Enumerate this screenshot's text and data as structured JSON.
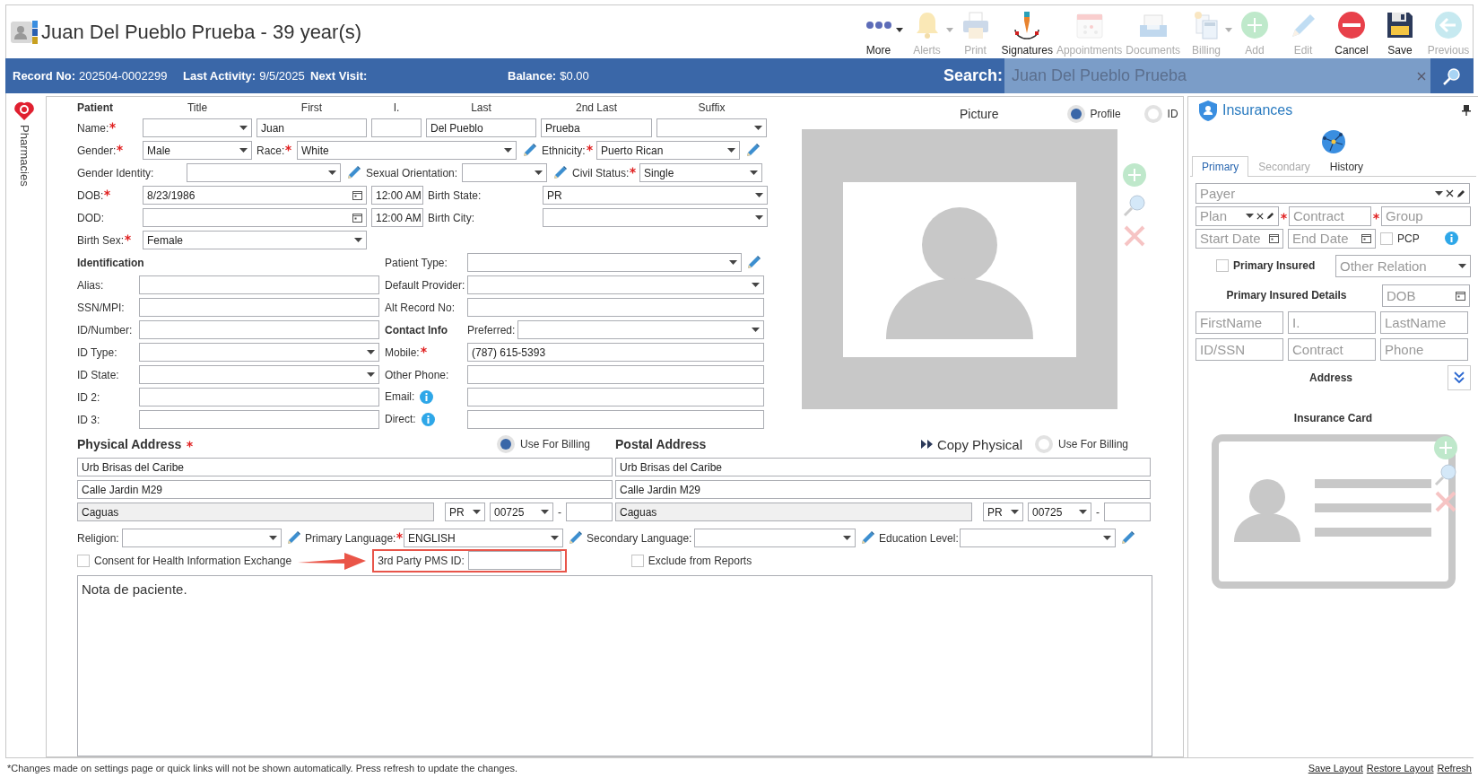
{
  "header": {
    "title": "Juan Del Pueblo Prueba - 39 year(s)"
  },
  "toolbar": [
    {
      "label": "More",
      "kind": "more",
      "disabled": false,
      "menu": true
    },
    {
      "label": "Alerts",
      "kind": "alerts",
      "disabled": true,
      "menu": true
    },
    {
      "label": "Print",
      "kind": "print",
      "disabled": true,
      "menu": false
    },
    {
      "label": "Signatures",
      "kind": "signatures",
      "disabled": false,
      "menu": false
    },
    {
      "label": "Appointments",
      "kind": "appointments",
      "disabled": true,
      "menu": false
    },
    {
      "label": "Documents",
      "kind": "documents",
      "disabled": true,
      "menu": false
    },
    {
      "label": "Billing",
      "kind": "billing",
      "disabled": true,
      "menu": true
    },
    {
      "label": "Add",
      "kind": "add",
      "disabled": true,
      "menu": false
    },
    {
      "label": "Edit",
      "kind": "edit",
      "disabled": true,
      "menu": false
    },
    {
      "label": "Cancel",
      "kind": "cancel",
      "disabled": false,
      "menu": false
    },
    {
      "label": "Save",
      "kind": "save",
      "disabled": false,
      "menu": false
    },
    {
      "label": "Previous",
      "kind": "previous",
      "disabled": true,
      "menu": false
    }
  ],
  "info_bar": {
    "items": [
      {
        "label": "Record No:",
        "value": "202504-0002299"
      },
      {
        "label": "Last Activity:",
        "value": "9/5/2025"
      },
      {
        "label": "Next Visit:"
      },
      {
        "label": "Balance:",
        "value": "$0.00"
      }
    ],
    "search": {
      "label": "Search:",
      "placeholder": "Juan Del Pueblo Prueba"
    }
  },
  "side_tab": {
    "label": "Pharmacies"
  },
  "patient": {
    "heading": "Patient",
    "columns": [
      "Title",
      "First",
      "I.",
      "Last",
      "2nd Last",
      "Suffix"
    ],
    "name": {
      "label": "Name:",
      "required": true,
      "first": "Juan",
      "last": "Del Pueblo",
      "second_last": "Prueba"
    },
    "gender": {
      "label": "Gender:",
      "required": true,
      "value": "Male"
    },
    "race": {
      "label": "Race:",
      "required": true,
      "value": "White"
    },
    "ethnicity": {
      "label": "Ethnicity:",
      "required": true,
      "value": "Puerto Rican"
    },
    "gender_identity": {
      "label": "Gender Identity:",
      "required": false
    },
    "sexual_orientation": {
      "label": "Sexual Orientation:",
      "required": false
    },
    "civil_status": {
      "label": "Civil Status:",
      "required": true,
      "value": "Single"
    },
    "dob": {
      "label": "DOB:",
      "required": true,
      "value": "8/23/1986",
      "time": "12:00 AM"
    },
    "birth_state": {
      "label": "Birth State:",
      "required": false,
      "value": "PR"
    },
    "dod": {
      "label": "DOD:",
      "required": false,
      "time": "12:00 AM"
    },
    "birth_city": {
      "label": "Birth City:",
      "required": false
    },
    "birth_sex": {
      "label": "Birth Sex:",
      "required": true,
      "value": "Female"
    }
  },
  "identification": {
    "heading": "Identification",
    "fields": [
      {
        "label": "Alias:",
        "kind": "text"
      },
      {
        "label": "SSN/MPI:",
        "kind": "text"
      },
      {
        "label": "ID/Number:",
        "kind": "text"
      },
      {
        "label": "ID Type:",
        "kind": "select"
      },
      {
        "label": "ID State:",
        "kind": "select"
      },
      {
        "label": "ID 2:",
        "kind": "text"
      },
      {
        "label": "ID 3:",
        "kind": "text"
      }
    ]
  },
  "details": [
    {
      "label": "Patient Type:",
      "kind": "select",
      "required": false,
      "pencil": true,
      "info": false
    },
    {
      "label": "Default Provider:",
      "kind": "select",
      "required": false,
      "pencil": false,
      "info": false
    },
    {
      "label": "Alt Record No:",
      "kind": "text",
      "required": false,
      "pencil": false,
      "info": false
    },
    {
      "label": "Contact Info",
      "kind": "heading",
      "sub_label": "Preferred:",
      "required": false,
      "pencil": false,
      "info": false
    },
    {
      "label": "Mobile:",
      "kind": "text",
      "value": "(787) 615-5393",
      "required": true,
      "pencil": false,
      "info": false
    },
    {
      "label": "Other Phone:",
      "kind": "text",
      "required": false,
      "pencil": false,
      "info": false
    },
    {
      "label": "Email:",
      "kind": "text",
      "required": false,
      "pencil": false,
      "info": true
    },
    {
      "label": "Direct:",
      "kind": "text",
      "required": false,
      "pencil": false,
      "info": true
    }
  ],
  "picture": {
    "heading": "Picture",
    "options": [
      {
        "label": "Profile",
        "selected": true
      },
      {
        "label": "ID",
        "selected": false
      }
    ]
  },
  "physical_address": {
    "heading": "Physical Address",
    "required": true,
    "billing": {
      "label": "Use For Billing",
      "selected": true
    },
    "line1": "Urb Brisas del Caribe",
    "line2": "Calle Jardin M29",
    "city": "Caguas",
    "state": "PR",
    "zip": "00725",
    "separator": "-"
  },
  "postal_address": {
    "heading": "Postal Address",
    "copy_label": "Copy Physical",
    "billing": {
      "label": "Use For Billing",
      "selected": false
    },
    "line1": "Urb Brisas del Caribe",
    "line2": "Calle Jardin M29",
    "city": "Caguas",
    "state": "PR",
    "zip": "00725",
    "separator": "-"
  },
  "other_fields": [
    {
      "label": "Religion:",
      "required": false
    },
    {
      "label": "Primary Language:",
      "required": true,
      "value": "ENGLISH"
    },
    {
      "label": "Secondary Language:",
      "required": false
    },
    {
      "label": "Education Level:",
      "required": false
    }
  ],
  "consent": {
    "label": "Consent for Health Information Exchange",
    "checked": false
  },
  "pms": {
    "label": "3rd Party PMS ID:"
  },
  "exclude": {
    "label": "Exclude from Reports",
    "checked": false
  },
  "notes": {
    "value": "Nota de paciente."
  },
  "insurances": {
    "title": "Insurances",
    "tabs": [
      {
        "label": "Primary",
        "selected": true,
        "disabled": false
      },
      {
        "label": "Secondary",
        "selected": false,
        "disabled": true
      },
      {
        "label": "History",
        "selected": false,
        "disabled": false
      }
    ],
    "payer": {
      "placeholder": "Payer"
    },
    "plan": {
      "placeholder": "Plan"
    },
    "contract": {
      "placeholder": "Contract",
      "required": true
    },
    "group": {
      "placeholder": "Group",
      "required": true
    },
    "start_date": {
      "placeholder": "Start Date"
    },
    "end_date": {
      "placeholder": "End Date"
    },
    "pcp": {
      "label": "PCP",
      "checked": false
    },
    "primary_insured": {
      "label": "Primary Insured",
      "checked": false
    },
    "other_relation": {
      "placeholder": "Other Relation"
    },
    "details_heading": "Primary Insured Details",
    "dob": {
      "placeholder": "DOB"
    },
    "insured_fields": [
      {
        "placeholder": "FirstName"
      },
      {
        "placeholder": "I."
      },
      {
        "placeholder": "LastName"
      },
      {
        "placeholder": "ID/SSN"
      },
      {
        "placeholder": "Contract"
      },
      {
        "placeholder": "Phone"
      }
    ],
    "address_heading": "Address",
    "card_heading": "Insurance Card"
  },
  "footer": {
    "note": "*Changes made on settings page or quick links will not be shown automatically. Press refresh to update the changes.",
    "links": [
      "Save Layout",
      "Restore Layout",
      "Refresh"
    ]
  }
}
